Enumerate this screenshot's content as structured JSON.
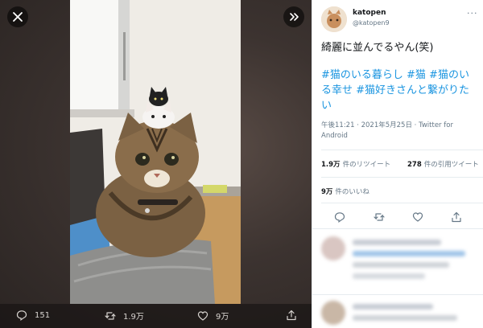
{
  "viewer": {
    "close_icon": "close-icon",
    "expand_icon": "collapse-panel-icon",
    "actions": {
      "reply_count": "151",
      "retweet_count": "1.9万",
      "like_count": "9万"
    }
  },
  "tweet": {
    "display_name": "katopen",
    "handle": "@katopen9",
    "text": "綺麗に並んでるやん(笑)",
    "hashtags": "#猫のいる暮らし #猫 #猫のいる幸せ #猫好きさんと繋がりたい",
    "timestamp": "午後11:21 · 2021年5月25日 · Twitter for Android",
    "retweets": {
      "value": "1.9万",
      "label": "件のリツイート"
    },
    "quotes": {
      "value": "278",
      "label": "件の引用ツイート"
    },
    "likes": {
      "value": "9万",
      "label": "件のいいね"
    }
  },
  "colors": {
    "link": "#1b95e0",
    "text": "#14171a",
    "muted": "#657786",
    "divider": "#e6ecf0"
  }
}
